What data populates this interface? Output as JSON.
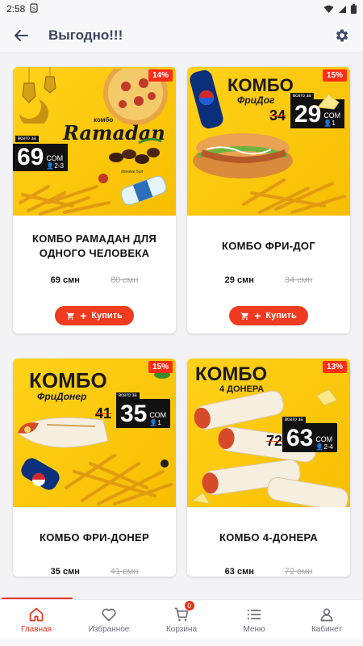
{
  "status": {
    "time": "2:58",
    "sim_icon": "sim-alert"
  },
  "appbar": {
    "title": "Выгодно!!!"
  },
  "products": [
    {
      "name": "КОМБО РАМАДАН ДЛЯ ОДНОГО ЧЕЛОВЕКА",
      "price": "69 смн",
      "old_price": "80 смн",
      "discount": "14%",
      "art": {
        "combo": "комбо",
        "title": "Ramadan",
        "price": "69",
        "currency": "СОМ",
        "persons": "2-3",
        "caption": "всего за",
        "extra": "финики 5шт"
      }
    },
    {
      "name": "КОМБО ФРИ-ДОГ",
      "price": "29 смн",
      "old_price": "34 смн",
      "discount": "15%",
      "art": {
        "combo": "КОМБО",
        "title": "ФриДог",
        "price": "29",
        "old": "34",
        "currency": "СОМ",
        "persons": "1",
        "caption": "всего за"
      }
    },
    {
      "name": "КОМБО ФРИ-ДОНЕР",
      "price": "35 смн",
      "old_price": "41 смн",
      "discount": "15%",
      "art": {
        "combo": "КОМБО",
        "title": "ФриДонер",
        "price": "35",
        "old": "41",
        "currency": "СОМ",
        "persons": "1",
        "caption": "всего за"
      }
    },
    {
      "name": "КОМБО 4-ДОНЕРА",
      "price": "63 смн",
      "old_price": "72 смн",
      "discount": "13%",
      "art": {
        "combo": "КОМБО",
        "title": "4 ДОНЕРА",
        "price": "63",
        "old": "72",
        "currency": "СОМ",
        "persons": "2-4",
        "caption": "всего за"
      }
    }
  ],
  "buy_label": "Купить",
  "nav": [
    {
      "label": "Главная",
      "icon": "home-icon",
      "active": true
    },
    {
      "label": "Избранное",
      "icon": "heart-icon"
    },
    {
      "label": "Корзина",
      "icon": "cart-icon",
      "badge": "0"
    },
    {
      "label": "Меню",
      "icon": "menu-icon"
    },
    {
      "label": "Кабинет",
      "icon": "user-icon"
    }
  ],
  "colors": {
    "accent": "#e8341c",
    "banner_yellow": "#ffd21a",
    "title_color": "#3b4458"
  }
}
